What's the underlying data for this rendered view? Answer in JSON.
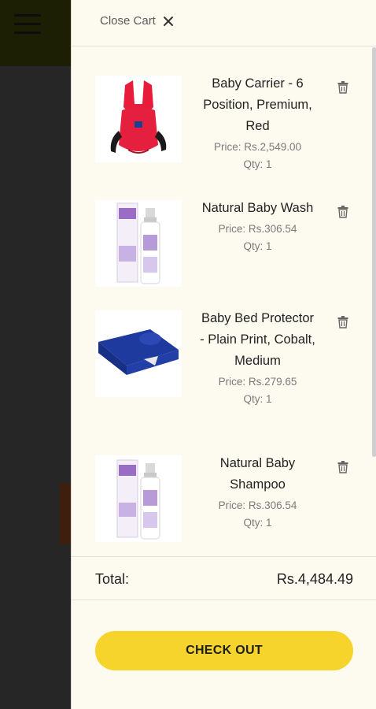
{
  "header": {
    "close_label": "Close Cart"
  },
  "cart": {
    "items": [
      {
        "name": "Baby Carrier - 6 Position, Premium, Red",
        "price": "Price: Rs.2,549.00",
        "qty": "Qty: 1",
        "image": "red-baby-carrier"
      },
      {
        "name": "Natural Baby Wash",
        "price": "Price: Rs.306.54",
        "qty": "Qty: 1",
        "image": "baby-wash-bottle"
      },
      {
        "name": "Baby Bed Protector - Plain Print, Cobalt, Medium",
        "price": "Price: Rs.279.65",
        "qty": "Qty: 1",
        "image": "cobalt-bed-protector"
      },
      {
        "name": "Natural Baby Shampoo",
        "price": "Price: Rs.306.54",
        "qty": "Qty: 1",
        "image": "baby-shampoo-bottle"
      }
    ],
    "total_label": "Total:",
    "total_value": "Rs.4,484.49",
    "checkout_label": "CHECK OUT"
  },
  "colors": {
    "accent": "#f6d42b",
    "drawer_bg": "#fdfbef",
    "backdrop": "#262626"
  }
}
